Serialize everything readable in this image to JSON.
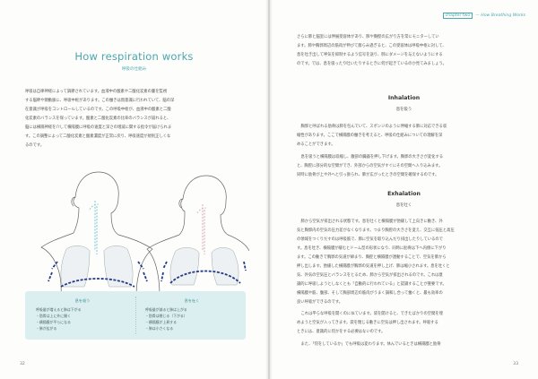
{
  "left": {
    "heading": "How respiration works",
    "subhead": "呼吸の仕組み",
    "intro": [
      "呼吸は自律神経によって調節されています。血液中の酸素や二酸化炭素の量を監視",
      "する脳幹や頸動脈に、呼吸中枢があります。この働きは無意識に行われていて、脳の深",
      "在意識が呼吸をコントロールしているのです。この呼吸中枢が、血液中の酸素と二酸",
      "化炭素のバランスを保っています。酸素と二酸化炭素の比率のバランスが崩れると、",
      "脳には横隔神経を介して横隔膜に呼吸の速度と深さの増減に関する指令が届けられま",
      "す。この調整によって二酸化炭素と酸素濃度が正常に戻り、呼吸速度が規則正しくな",
      "るのです。"
    ],
    "caption": {
      "inhale": {
        "title": "息を吸う",
        "items": [
          "呼吸量が増えると肺は下がる",
          "・肋骨は上に外に開く",
          "・横隔膜が平らになる",
          "・肺が広がる"
        ]
      },
      "exhale": {
        "title": "息を吐く",
        "items": [
          "呼吸量が減ると肺は上がる",
          "・肋骨は閉じる（下がる）",
          "・横隔膜が上昇する",
          "・肺は小さくなる"
        ]
      }
    },
    "page_number": "32"
  },
  "right": {
    "chapter_number": "chapter two",
    "chapter_title": "— How Breathing Works",
    "intro": [
      "さらに肺と脳室には伸展受容体があり、肺や胸壁の広がり方を常にモニターしてい",
      "ます。肺や胸郭周辺の筋肉が伸びて膨らみ過ぎると、この受容体は呼吸中枢に対して、",
      "息を吐き出して呼気を抑制するよう信号を送り、肺にダメージを与えないようにする",
      "のです。では、息を吸ったり吐いたりするときに何が起きているのか見てみましょう。"
    ],
    "inhalation": {
      "title": "Inhalation",
      "subtitle": "息を吸う",
      "paras": [
        [
          "胸郭と呼ばれる肋骨は肺を包んでいて、スポンジのように伸縮する肺に対応できる収",
          "縮性があります。ここで横隔膜の働きを考えると、呼吸の仕組みについての理解を深",
          "めることができます。"
        ],
        [
          "息を吸うと横隔膜は収縮し、腹部の臓器を押し下げます。胸郭の大きさが変化する",
          "と、胸腔に部分的な空間ができ、外部からの空気がすぐにその空間へ入り込みます。",
          "同時に肋骨が上や外へと引っ張られ、肺が広がったときの空間を確保するのです。"
        ]
      ]
    },
    "exhalation": {
      "title": "Exhalation",
      "subtitle": "息を吐く",
      "paras": [
        [
          "肺から空気が排出される状態です。息を吐くと横隔膜が弛緩して上向きに動き、外",
          "気と胸郭内の空気の圧力差がなくなります。つまり胸腔の大きさを変え、交互に低圧と高圧",
          "の領域をつくりだすのは呼吸筋で、肺に空気を取り込んだり排出したりしているので",
          "す。息を吐き、横隔膜が緩むとドーム型の形状になり、同時に肋骨は下へ内側に下がり",
          "ます。この動きで胸郭の気道が締まり、胸腔と横隔膜が連動することで、空気を肺から",
          "押し出します。弛緩した横隔膜が胸郭の気道を押し上げ、肺は縮小されます。息を吐くと",
          "気、外気の空気圧とバランスをとるため、肺から空気が排出されるのです。これは意",
          "識的に呼吸しようとしなくとも「自動的に行われている」と認識することが重要です。",
          "横隔膜や筋、腹部、そして胸部周辺の筋肉がうまく調和し合って働くと、最も効率の",
          "良い呼吸ができるのです。"
        ],
        [
          "これは平らな呼吸を開くのに似ています。袋を開けると、できたばかりの空間を埋",
          "めようと空気が入ってきます。袋を閉じる動きに空気は押し出されます。呼吸する",
          "ときには、意識的に何かをする必要はないのです。"
        ],
        [
          "また、「何をしているか」でも呼吸は変わります。休んでいるときは横隔膜と肋骨"
        ]
      ]
    },
    "page_number": "33"
  }
}
